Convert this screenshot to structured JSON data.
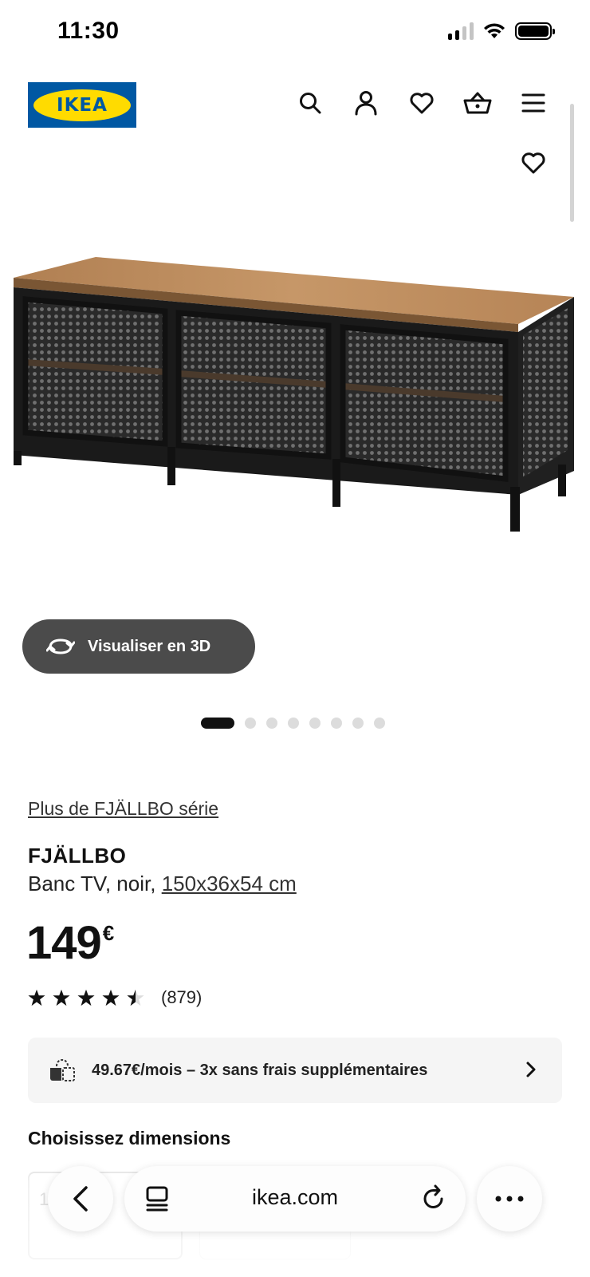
{
  "status_bar": {
    "time": "11:30"
  },
  "header": {
    "logo_text": "IKEA",
    "icons": [
      "search-icon",
      "account-icon",
      "heart-icon",
      "basket-icon",
      "menu-icon"
    ]
  },
  "carousel": {
    "total_slides": 8,
    "active_slide": 1
  },
  "view_3d": {
    "label": "Visualiser en 3D",
    "icon": "rotate-3d-icon"
  },
  "product": {
    "series_link": "Plus de FJÄLLBO série",
    "name": "FJÄLLBO",
    "description": "Banc TV, noir,",
    "dimensions": "150x36x54 cm",
    "price": "149",
    "currency": "€",
    "rating": 4.5,
    "rating_max": 5,
    "review_count": "(879)"
  },
  "payment": {
    "text": "49.67€/mois – 3x sans frais supplémentaires",
    "icon": "installment-icon"
  },
  "dimensions_section": {
    "title": "Choisissez dimensions",
    "option_1_visible_text": "1",
    "option_1_partial_text": ":5"
  },
  "browser": {
    "url": "ikea.com"
  },
  "colors": {
    "brand_blue": "#0058a3",
    "brand_yellow": "#ffdb00",
    "dark_button": "#4b4b4b"
  }
}
